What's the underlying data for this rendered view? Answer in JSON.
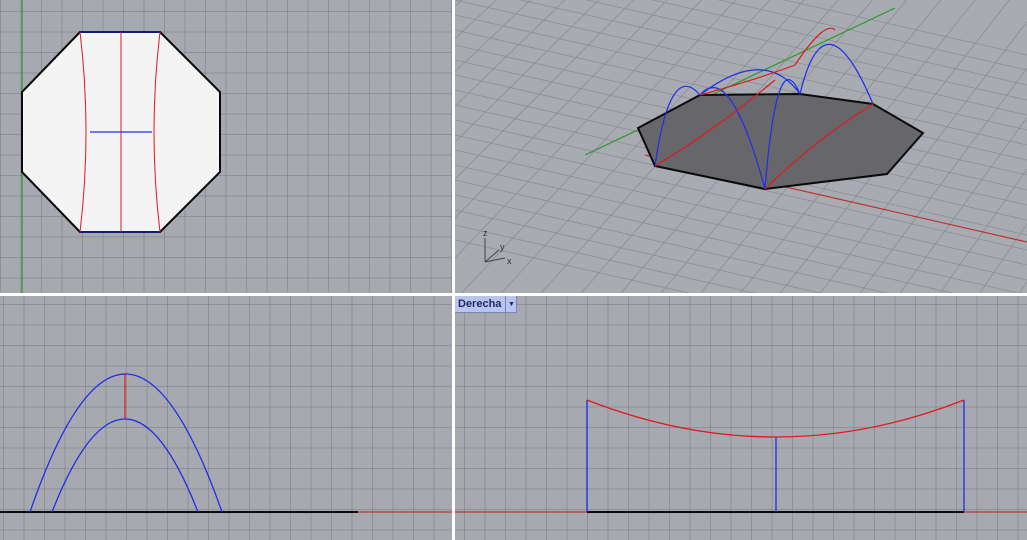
{
  "viewports": {
    "active_label": "Derecha",
    "axis_icon": {
      "z": "z",
      "y": "y",
      "x": "x"
    }
  },
  "colors": {
    "viewport_bg": "#a6a9b0",
    "grid": "#5a5e66",
    "x_axis": "#c0342c",
    "y_axis": "#2c9a2c",
    "curve_red": "#e01a1a",
    "curve_blue": "#1f2ee8",
    "surface_fill": "#f4f4f5",
    "shaded_fill": "#66666b",
    "outline": "#0a0a0a",
    "divider": "#ffffff"
  },
  "icons": [
    "dropdown-caret-icon",
    "axis-triad-icon"
  ]
}
